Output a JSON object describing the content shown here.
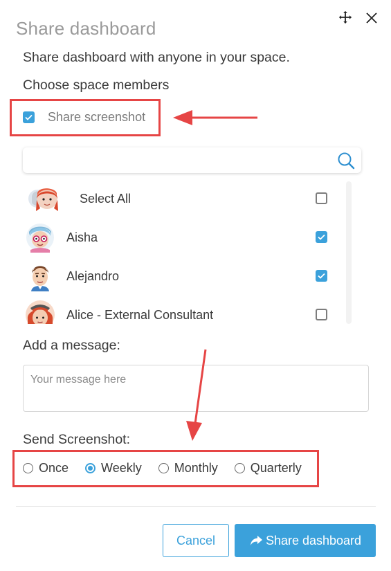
{
  "dialog": {
    "title": "Share dashboard",
    "subtitle": "Share dashboard with anyone in your space.",
    "choose_label": "Choose space members"
  },
  "share_screenshot": {
    "label": "Share screenshot",
    "checked": true
  },
  "search": {
    "placeholder": "",
    "value": ""
  },
  "members": [
    {
      "name": "Select All",
      "checked": false,
      "avatar": "group-avatar-icon"
    },
    {
      "name": "Aisha",
      "checked": true,
      "avatar": "woman-glasses-avatar-icon"
    },
    {
      "name": "Alejandro",
      "checked": true,
      "avatar": "man-avatar-icon"
    },
    {
      "name": "Alice - External Consultant",
      "checked": false,
      "avatar": "woman-hat-avatar-icon"
    }
  ],
  "message": {
    "label": "Add a message:",
    "placeholder": "Your message here",
    "value": ""
  },
  "send_screenshot": {
    "label": "Send Screenshot:",
    "options": [
      "Once",
      "Weekly",
      "Monthly",
      "Quarterly"
    ],
    "selected": "Weekly"
  },
  "buttons": {
    "cancel": "Cancel",
    "share": "Share dashboard"
  },
  "colors": {
    "accent": "#3ba1db",
    "annotation": "#e64545",
    "title": "#9a9a9a"
  },
  "icons": [
    "move-icon",
    "close-icon",
    "search-icon",
    "share-arrow-icon",
    "checkbox-checked-icon",
    "radio-selected-icon"
  ]
}
